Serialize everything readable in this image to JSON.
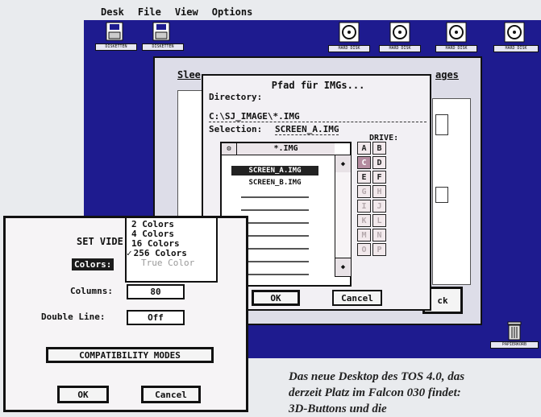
{
  "menubar": {
    "items": [
      "Desk",
      "File",
      "View",
      "Options"
    ]
  },
  "desktop": {
    "icons": [
      {
        "label": "DISKETTEN",
        "type": "floppy"
      },
      {
        "label": "DISKETTEN",
        "type": "floppy"
      },
      {
        "label": "HARD DISK",
        "type": "harddisk"
      },
      {
        "label": "HARD DISK",
        "type": "harddisk"
      },
      {
        "label": "HARD DISK",
        "type": "harddisk"
      },
      {
        "label": "HARD DISK",
        "type": "harddisk"
      }
    ],
    "trash_label": "PAPIERKORB",
    "colors": {
      "desktop": "#1e1b8f",
      "window_bg": "#dddde8"
    }
  },
  "bg_window": {
    "title_left": "Slee",
    "title_right": "ages",
    "back_button": "ck"
  },
  "file_selector": {
    "title": "Pfad für IMGs...",
    "directory_label": "Directory:",
    "directory_value": "C:\\SJ_IMAGE\\*.IMG",
    "selection_label": "Selection:",
    "selection_value": "SCREEN_A.IMG",
    "list_title": "*.IMG",
    "files": [
      "SCREEN_A.IMG",
      "SCREEN_B.IMG"
    ],
    "drive_label": "DRIVE:",
    "drives": [
      "A",
      "B",
      "C",
      "D",
      "E",
      "F",
      "G",
      "H",
      "I",
      "J",
      "K",
      "L",
      "M",
      "N",
      "O",
      "P"
    ],
    "selected_drive": "C",
    "ok": "OK",
    "cancel": "Cancel",
    "colors": {
      "selected_drive": "#b48ca0",
      "drive_cell": "#f2e9ec"
    }
  },
  "video_dialog": {
    "title": "SET VIDE",
    "colors_label": "Colors:",
    "columns_label": "Columns:",
    "columns_value": "80",
    "double_line_label": "Double Line:",
    "double_line_value": "Off",
    "compat_button": "COMPATIBILITY MODES",
    "ok": "OK",
    "cancel": "Cancel"
  },
  "color_menu": {
    "options": [
      "2 Colors",
      "4 Colors",
      "16 Colors",
      "256 Colors",
      "True Color"
    ],
    "checked": "256 Colors",
    "check_mark": "✓",
    "disabled": "True Color"
  },
  "caption": {
    "line1": "Das neue Desktop des TOS 4.0, das",
    "line2": "derzeit Platz im Falcon 030 findet:",
    "line3": "3D-Buttons und die"
  }
}
